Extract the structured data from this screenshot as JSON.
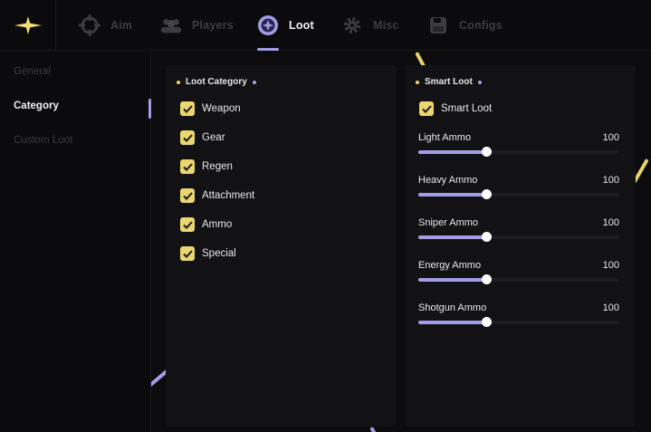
{
  "colors": {
    "accent": "#a59ce6",
    "check": "#e9d66f",
    "streak_yellow": "#e6d36c",
    "streak_purple": "#a59ce6"
  },
  "logo": {
    "icon": "sparkle-star-icon"
  },
  "tabs": [
    {
      "label": "Aim",
      "icon": "crosshair-icon",
      "active": false
    },
    {
      "label": "Players",
      "icon": "users-icon",
      "active": false
    },
    {
      "label": "Loot",
      "icon": "loot-orb-icon",
      "active": true
    },
    {
      "label": "Misc",
      "icon": "gear-icon",
      "active": false
    },
    {
      "label": "Configs",
      "icon": "save-disk-icon",
      "active": false
    }
  ],
  "sidebar": {
    "items": [
      {
        "label": "General",
        "active": false
      },
      {
        "label": "Category",
        "active": true
      },
      {
        "label": "Custom Loot",
        "active": false
      }
    ]
  },
  "loot_category": {
    "title": "Loot Category",
    "items": [
      {
        "label": "Weapon",
        "checked": true
      },
      {
        "label": "Gear",
        "checked": true
      },
      {
        "label": "Regen",
        "checked": true
      },
      {
        "label": "Attachment",
        "checked": true
      },
      {
        "label": "Ammo",
        "checked": true
      },
      {
        "label": "Special",
        "checked": true
      }
    ]
  },
  "smart_loot": {
    "title": "Smart Loot",
    "toggle": {
      "label": "Smart Loot",
      "checked": true
    },
    "sliders": [
      {
        "label": "Light Ammo",
        "value": "100",
        "fill_fraction": 0.34
      },
      {
        "label": "Heavy Ammo",
        "value": "100",
        "fill_fraction": 0.34
      },
      {
        "label": "Sniper Ammo",
        "value": "100",
        "fill_fraction": 0.34
      },
      {
        "label": "Energy Ammo",
        "value": "100",
        "fill_fraction": 0.34
      },
      {
        "label": "Shotgun Ammo",
        "value": "100",
        "fill_fraction": 0.34
      }
    ]
  }
}
